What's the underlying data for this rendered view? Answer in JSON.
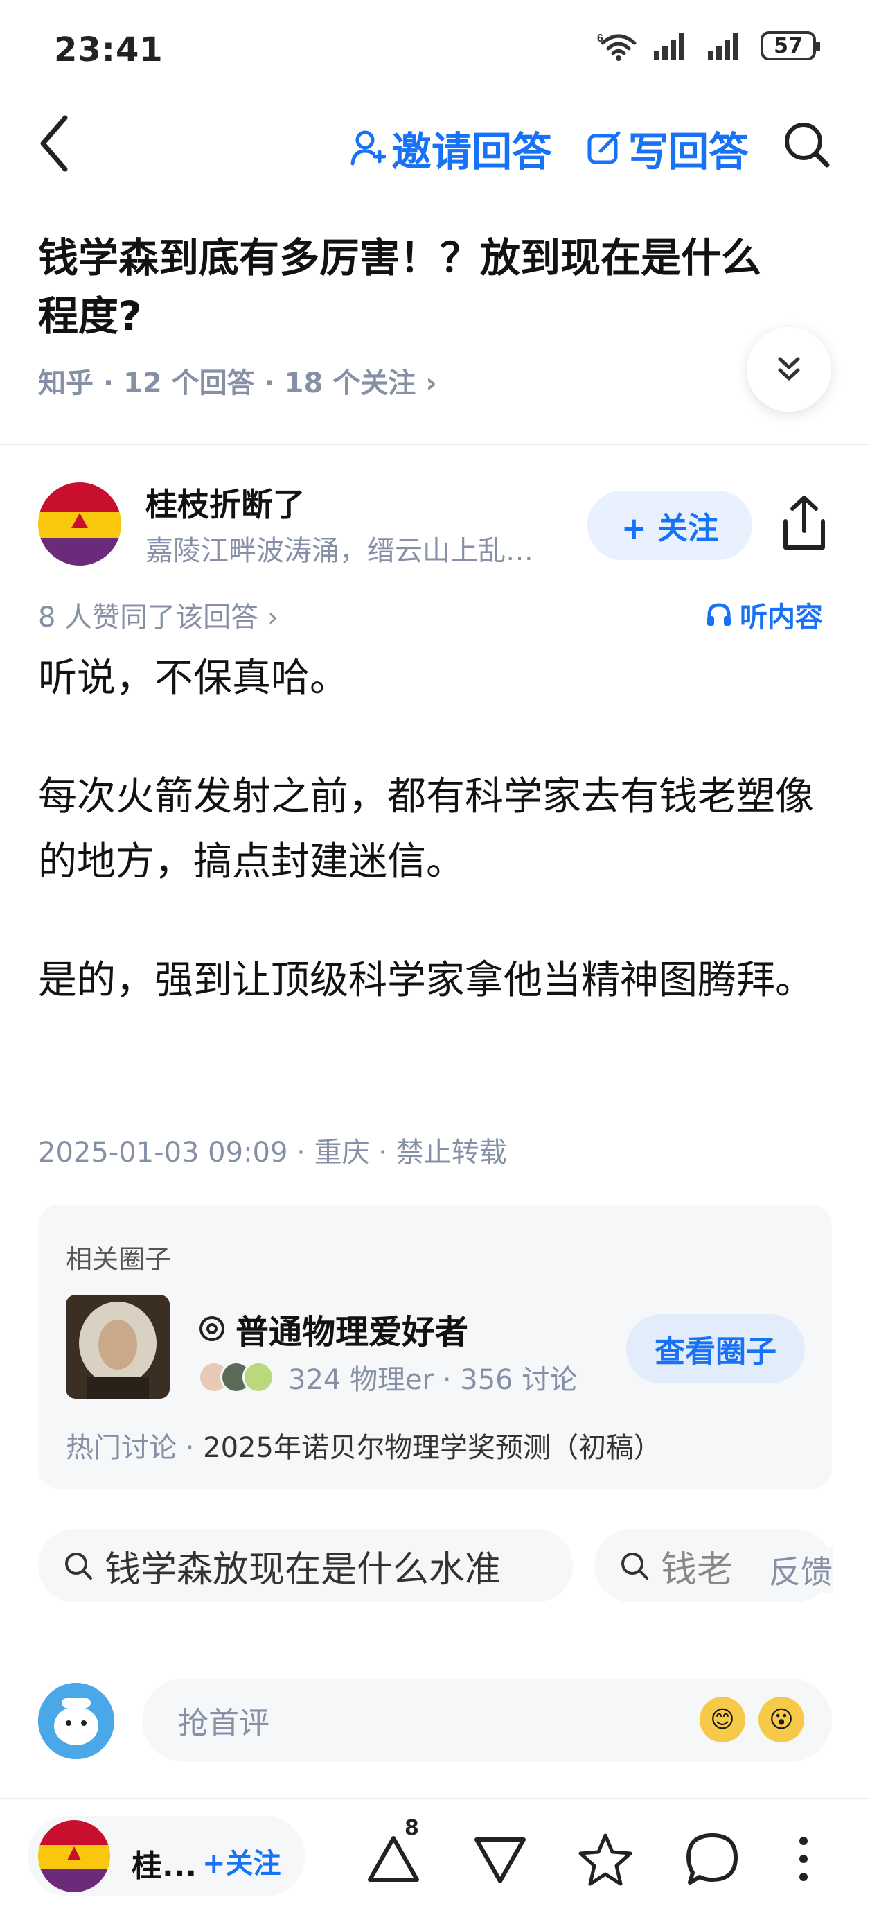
{
  "status_bar": {
    "time": "23:41",
    "signal_label": "6",
    "battery": "57"
  },
  "nav": {
    "invite_label": "邀请回答",
    "write_label": "写回答"
  },
  "question": {
    "title": "钱学森到底有多厉害！？放到现在是什么程度?",
    "meta": "知乎 · 12 个回答 · 18 个关注 ›"
  },
  "author": {
    "name": "桂枝折断了",
    "bio": "嘉陵江畔波涛涌，缙云山上乱…",
    "follow_label": "+ 关注"
  },
  "answer": {
    "likes": "8 人赞同了该回答 ›",
    "listen_label": "听内容",
    "paragraphs": [
      "听说，不保真哈。",
      "每次火箭发射之前，都有科学家去有钱老塑像的地方，搞点封建迷信。",
      "是的，强到让顶级科学家拿他当精神图腾拜。"
    ],
    "meta": "2025-01-03 09:09 · 重庆 · 禁止转载"
  },
  "circle": {
    "heading": "相关圈子",
    "name": "普通物理爱好者",
    "stats": "324 物理er · 356 讨论",
    "button": "查看圈子",
    "hot_label": "热门讨论",
    "hot_topic": "2025年诺贝尔物理学奖预测（初稿）"
  },
  "related_searches": [
    "钱学森放现在是什么水准",
    "钱老"
  ],
  "feedback_label": "反馈",
  "comment": {
    "placeholder": "抢首评"
  },
  "bottom_bar": {
    "author_short": "桂...",
    "follow_label": "+关注",
    "upvote_count": "8"
  },
  "colors": {
    "accent": "#1772f6",
    "meta_gray": "#8590a6",
    "card_bg": "#f6f7f9"
  }
}
